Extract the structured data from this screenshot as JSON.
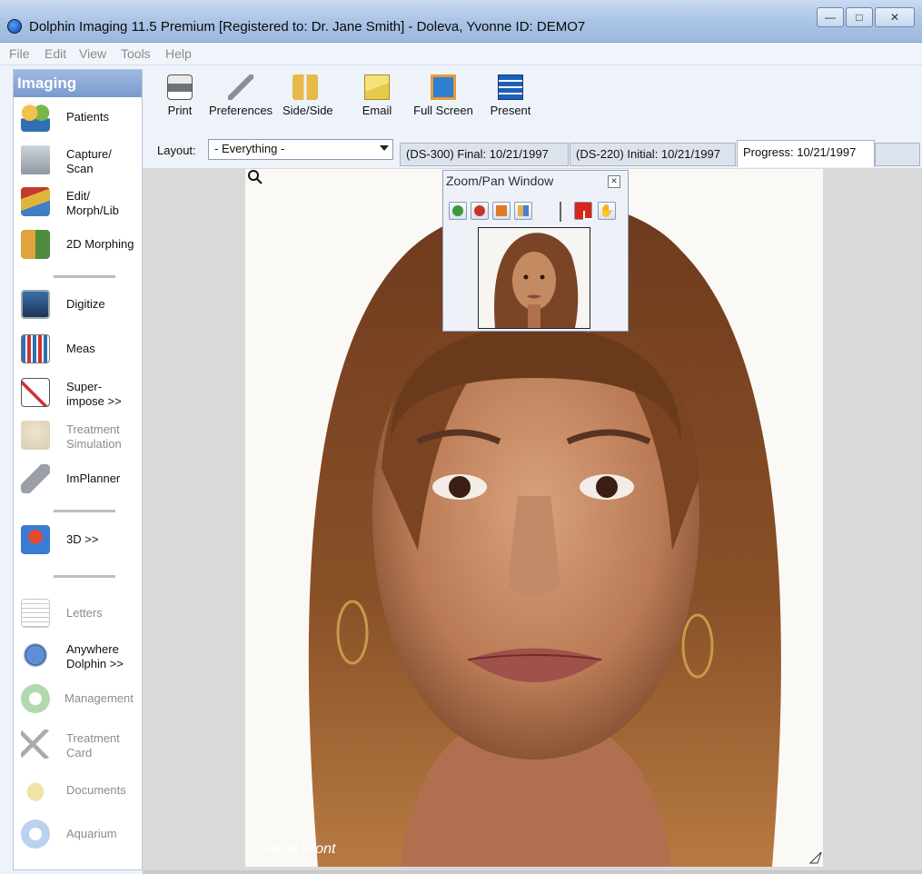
{
  "window": {
    "title": "Dolphin Imaging 11.5 Premium [Registered to: Dr. Jane Smith] - Doleva, Yvonne  ID: DEMO7",
    "controls": [
      "minimize",
      "maximize",
      "close"
    ]
  },
  "menu": [
    "File",
    "Edit",
    "View",
    "Tools",
    "Help"
  ],
  "sidebar": {
    "header": "Imaging",
    "items": [
      {
        "label": "Patients",
        "icon": "patients-icon",
        "enabled": true
      },
      {
        "label": "Capture/\nScan",
        "icon": "capture-scan-icon",
        "enabled": true
      },
      {
        "label": "Edit/\nMorph/Lib",
        "icon": "edit-morph-icon",
        "enabled": true
      },
      {
        "label": "2D Morphing",
        "icon": "morphing-icon",
        "enabled": true
      },
      {
        "label": "Digitize",
        "icon": "digitize-icon",
        "enabled": true
      },
      {
        "label": "Meas",
        "icon": "measure-icon",
        "enabled": true
      },
      {
        "label": "Super-\nimpose >>",
        "icon": "superimpose-icon",
        "enabled": true
      },
      {
        "label": "Treatment\nSimulation",
        "icon": "treatment-simulation-icon",
        "enabled": false
      },
      {
        "label": "ImPlanner",
        "icon": "implanner-icon",
        "enabled": true
      },
      {
        "label": "3D >>",
        "icon": "3d-cube-icon",
        "enabled": true
      },
      {
        "label": "Letters",
        "icon": "letters-icon",
        "enabled": false
      },
      {
        "label": "Anywhere\nDolphin >>",
        "icon": "anywhere-dolphin-icon",
        "enabled": true
      },
      {
        "label": "Management",
        "icon": "management-icon",
        "enabled": false
      },
      {
        "label": "Treatment\nCard",
        "icon": "treatment-card-icon",
        "enabled": false
      },
      {
        "label": "Documents",
        "icon": "documents-icon",
        "enabled": false
      },
      {
        "label": "Aquarium",
        "icon": "aquarium-icon",
        "enabled": false
      }
    ]
  },
  "toolbar": {
    "print": "Print",
    "preferences": "Preferences",
    "side_side": "Side/Side",
    "email": "Email",
    "full_screen": "Full Screen",
    "present": "Present"
  },
  "layout_bar": {
    "label": "Layout:",
    "selected": "- Everything -",
    "tabs": [
      {
        "label": "(DS-300) Final: 10/21/1997",
        "active": false
      },
      {
        "label": "(DS-220) Initial: 10/21/1997",
        "active": false
      },
      {
        "label": "Progress: 10/21/1997",
        "active": true
      }
    ]
  },
  "image": {
    "caption": "Facial Front"
  },
  "zoom_pan": {
    "title": "Zoom/Pan Window",
    "tools": [
      "zoom-in-icon",
      "zoom-out-icon",
      "zoom-fit-icon",
      "zoom-actual-icon",
      "region-select-icon",
      "hand-pan-icon"
    ]
  },
  "colors": {
    "title_bar": "#a9c3e4",
    "sidebar_header": "#7a9bd0",
    "photo_background": "#d9d9d9",
    "disabled_text": "#8c8c8c"
  }
}
